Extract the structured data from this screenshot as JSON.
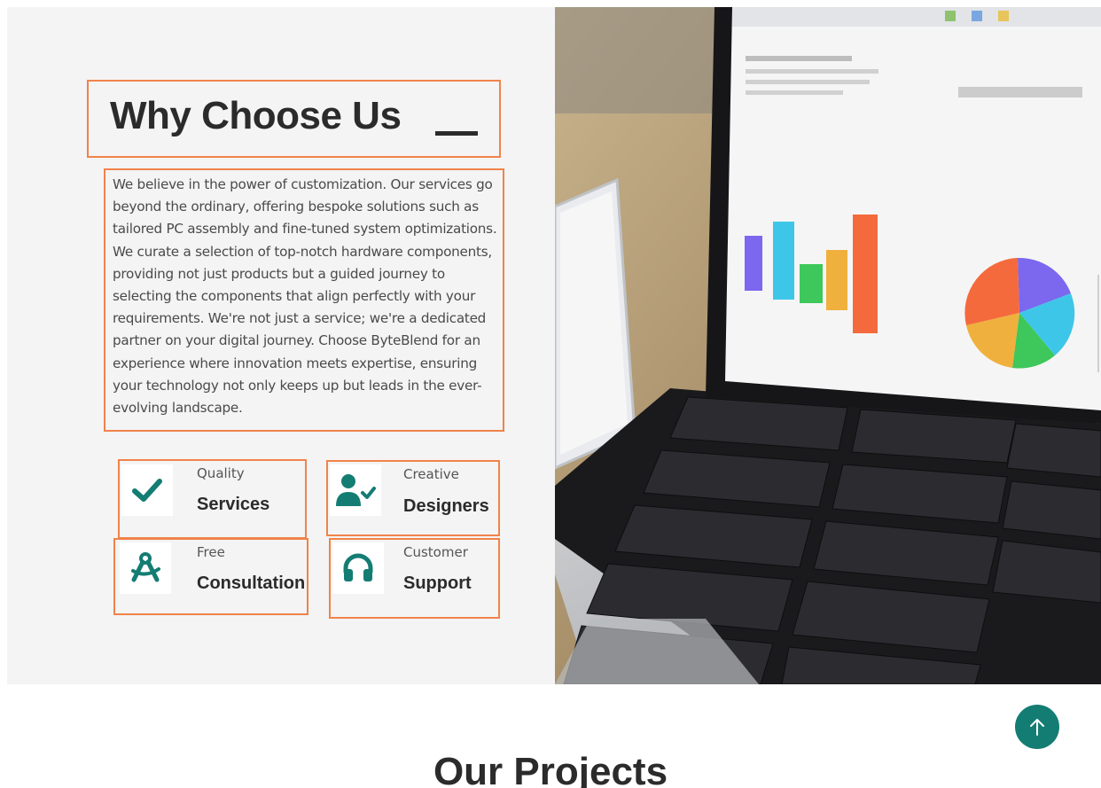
{
  "about": {
    "title": "Why Choose Us",
    "description": "We believe in the power of customization. Our services go beyond the ordinary, offering bespoke solutions such as tailored PC assembly and fine-tuned system optimizations. We curate a selection of top-notch hardware components, providing not just products but a guided journey to selecting the components that align perfectly with your requirements. We're not just a service; we're a dedicated partner on your digital journey. Choose ByteBlend for an experience where innovation meets expertise, ensuring your technology not only keeps up but leads in the ever-evolving landscape.",
    "features": [
      {
        "small": "Quality",
        "big": "Services",
        "icon": "check-icon"
      },
      {
        "small": "Creative",
        "big": "Designers",
        "icon": "user-check-icon"
      },
      {
        "small": "Free",
        "big": "Consultation",
        "icon": "drafting-compass-icon"
      },
      {
        "small": "Customer",
        "big": "Support",
        "icon": "headphones-icon"
      }
    ]
  },
  "projects": {
    "heading": "Our Projects"
  },
  "colors": {
    "accent": "#147d73",
    "highlight_border": "#f0834a",
    "section_bg": "#f4f4f4",
    "heading": "#2b2b2b"
  }
}
